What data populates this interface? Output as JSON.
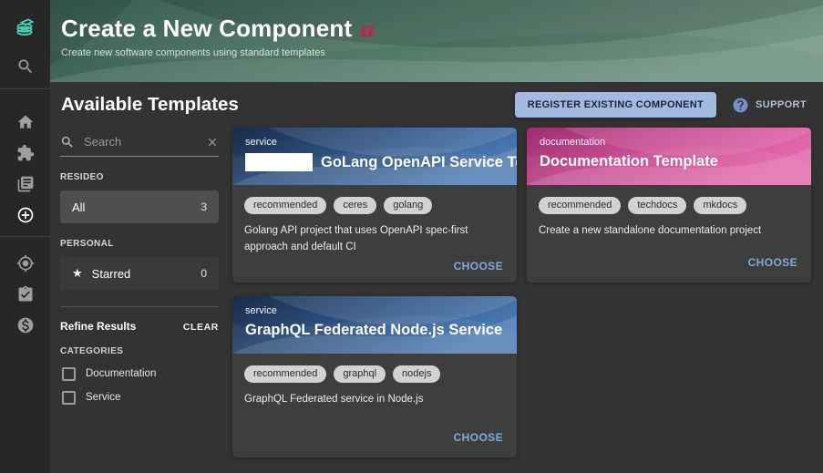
{
  "app": {
    "page_title": "Create a New Component",
    "alpha_badge": "α",
    "page_subtitle": "Create new software components using standard templates"
  },
  "sidebar": {
    "icons": [
      "logo-stack-icon",
      "search-icon",
      "home-icon",
      "extensions-puzzle-icon",
      "docs-library-icon",
      "create-plus-circle-icon",
      "locate-target-icon",
      "audit-clipboard-check-icon",
      "cost-dollar-icon"
    ]
  },
  "content": {
    "heading": "Available Templates",
    "register_button": "REGISTER EXISTING COMPONENT",
    "support_label": "SUPPORT"
  },
  "filters": {
    "search_placeholder": "Search",
    "groups": [
      {
        "label": "RESIDEO",
        "items": [
          {
            "label": "All",
            "count": "3",
            "selected": true
          }
        ]
      },
      {
        "label": "PERSONAL",
        "items": [
          {
            "label": "Starred",
            "count": "0",
            "selected": false
          }
        ]
      }
    ],
    "refine": {
      "title": "Refine Results",
      "clear_label": "CLEAR",
      "categories_label": "CATEGORIES",
      "options": [
        "Documentation",
        "Service"
      ]
    }
  },
  "cards": [
    {
      "type": "service",
      "title": "GoLang OpenAPI Service Template",
      "has_logo_placeholder": true,
      "tags": [
        "recommended",
        "ceres",
        "golang"
      ],
      "description": "Golang API project that uses OpenAPI spec-first approach and default CI",
      "action": "CHOOSE",
      "header_theme": "blue"
    },
    {
      "type": "documentation",
      "title": "Documentation Template",
      "has_logo_placeholder": false,
      "tags": [
        "recommended",
        "techdocs",
        "mkdocs"
      ],
      "description": "Create a new standalone documentation project",
      "action": "CHOOSE",
      "header_theme": "pink"
    },
    {
      "type": "service",
      "title": "GraphQL Federated Node.js Service",
      "has_logo_placeholder": false,
      "tags": [
        "recommended",
        "graphql",
        "nodejs"
      ],
      "description": "GraphQL Federated service in Node.js",
      "action": "CHOOSE",
      "header_theme": "blue"
    }
  ],
  "colors": {
    "sidebar_bg": "#272727",
    "page_bg": "#333333",
    "card_bg": "#3e3e3e",
    "header_green_dark": "#2d5346",
    "header_green_light": "#6e9181",
    "card_blue_dark": "#1a3050",
    "card_blue_light": "#4878b0",
    "card_pink_dark": "#9c2f6e",
    "card_pink_light": "#e468ab",
    "accent_teal": "#3fd6bd",
    "alpha_badge": "#c21f55",
    "register_button_bg": "#a2b9e2",
    "choose_link": "#83a8da",
    "chip_bg": "#d2d2d2"
  }
}
